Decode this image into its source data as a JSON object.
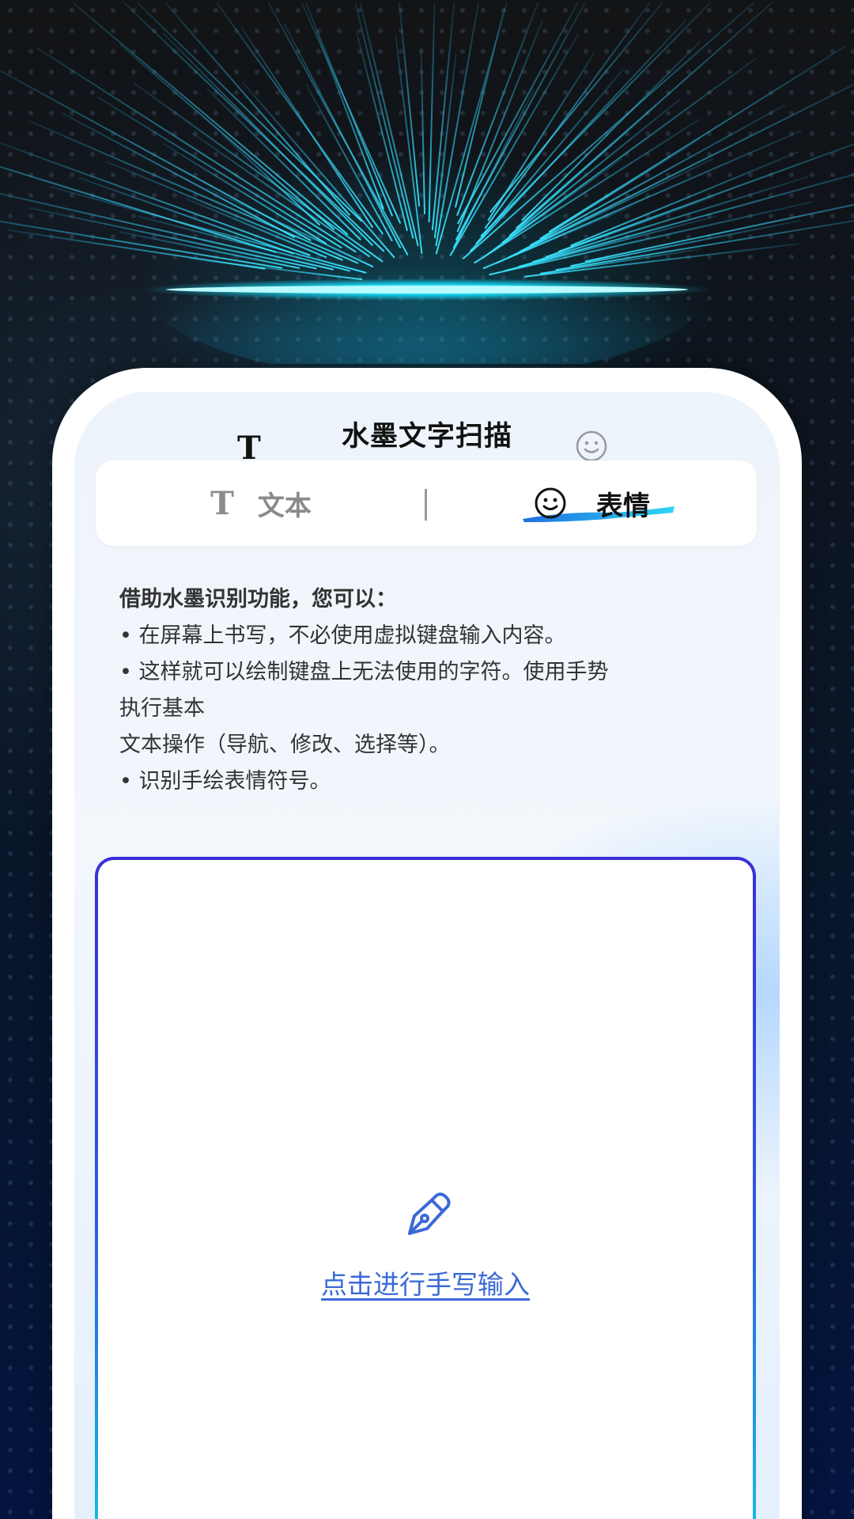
{
  "app": {
    "title": "水墨文字扫描",
    "header_text_glyph": "T",
    "header_emoji_icon": "smiley-icon"
  },
  "tabs": [
    {
      "glyph": "T",
      "label": "文本",
      "active": false
    },
    {
      "icon": "smiley-icon",
      "label": "表情",
      "active": true
    }
  ],
  "description": {
    "lead": "借助水墨识别功能，您可以：",
    "lines": [
      "• 在屏幕上书写，不必使用虚拟键盘输入内容。",
      "• 这样就可以绘制键盘上无法使用的字符。使用手势",
      "执行基本",
      "文本操作（导航、修改、选择等）。",
      "• 识别手绘表情符号。"
    ]
  },
  "handwriting_pad": {
    "icon": "pen-nib-icon",
    "prompt": "点击进行手写输入"
  },
  "colors": {
    "accent_blue": "#3b6ad6",
    "glow_cyan": "#19e3ff",
    "pad_border_top": "#3a2fd6",
    "pad_border_bottom": "#17c7e6"
  }
}
